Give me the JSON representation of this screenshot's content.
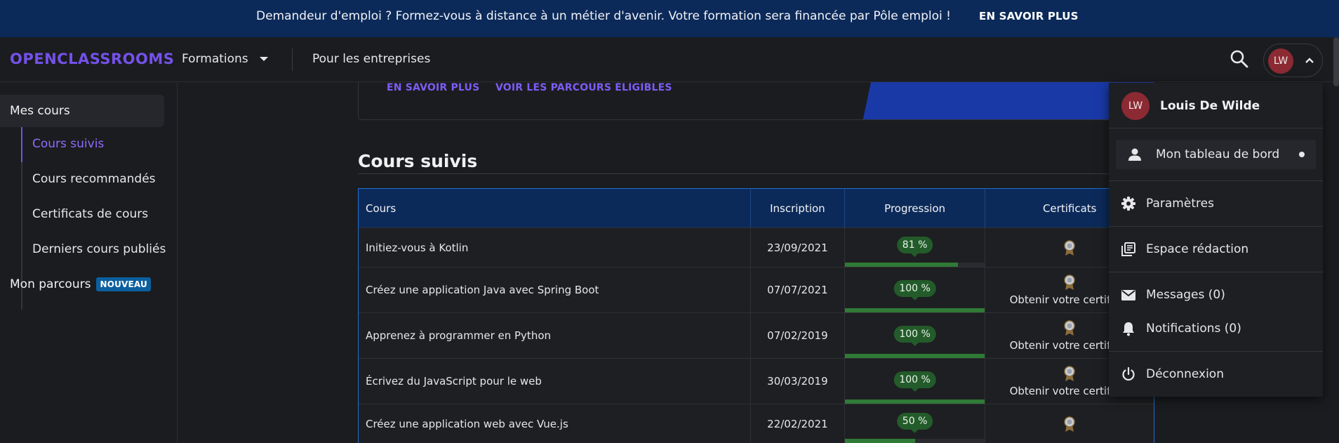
{
  "banner": {
    "message": "Demandeur d'emploi ? Formez-vous à distance à un métier d'avenir. Votre formation sera financée par Pôle emploi !",
    "cta": "EN SAVOIR PLUS"
  },
  "header": {
    "logo": "OPENCLASSROOMS",
    "formations": "Formations",
    "entreprises": "Pour les entreprises",
    "avatar_initials": "LW"
  },
  "sidebar": {
    "mes_cours": "Mes cours",
    "items": [
      {
        "label": "Cours suivis",
        "active": true
      },
      {
        "label": "Cours recommandés",
        "active": false
      },
      {
        "label": "Certificats de cours",
        "active": false
      },
      {
        "label": "Derniers cours publiés",
        "active": false
      }
    ],
    "parcours": "Mon parcours",
    "parcours_badge": "NOUVEAU"
  },
  "promo": {
    "link1": "EN SAVOIR PLUS",
    "link2": "VOIR LES PARCOURS ÉLIGIBLES"
  },
  "main": {
    "title": "Cours suivis",
    "table": {
      "headers": [
        "Cours",
        "Inscription",
        "Progression",
        "Certificats"
      ],
      "rows": [
        {
          "course": "Initiez-vous à Kotlin",
          "date": "23/09/2021",
          "progress": 81,
          "progress_label": "81 %",
          "cert_text": ""
        },
        {
          "course": "Créez une application Java avec Spring Boot",
          "date": "07/07/2021",
          "progress": 100,
          "progress_label": "100 %",
          "cert_text": "Obtenir votre certificat"
        },
        {
          "course": "Apprenez à programmer en Python",
          "date": "07/02/2019",
          "progress": 100,
          "progress_label": "100 %",
          "cert_text": "Obtenir votre certificat"
        },
        {
          "course": "Écrivez du JavaScript pour le web",
          "date": "30/03/2019",
          "progress": 100,
          "progress_label": "100 %",
          "cert_text": "Obtenir votre certificat"
        },
        {
          "course": "Créez une application web avec Vue.js",
          "date": "22/02/2021",
          "progress": 50,
          "progress_label": "50 %",
          "cert_text": ""
        }
      ]
    }
  },
  "dropdown": {
    "initials": "LW",
    "name": "Louis De Wilde",
    "tableau": "Mon tableau de bord",
    "parametres": "Paramètres",
    "redaction": "Espace rédaction",
    "messages": "Messages (0)",
    "notifications": "Notifications (0)",
    "deconnexion": "Déconnexion"
  },
  "colors": {
    "brand": "#7451eb",
    "banner": "#0c2a59",
    "progress": "#2f7a36",
    "avatar": "#8c2a33"
  }
}
